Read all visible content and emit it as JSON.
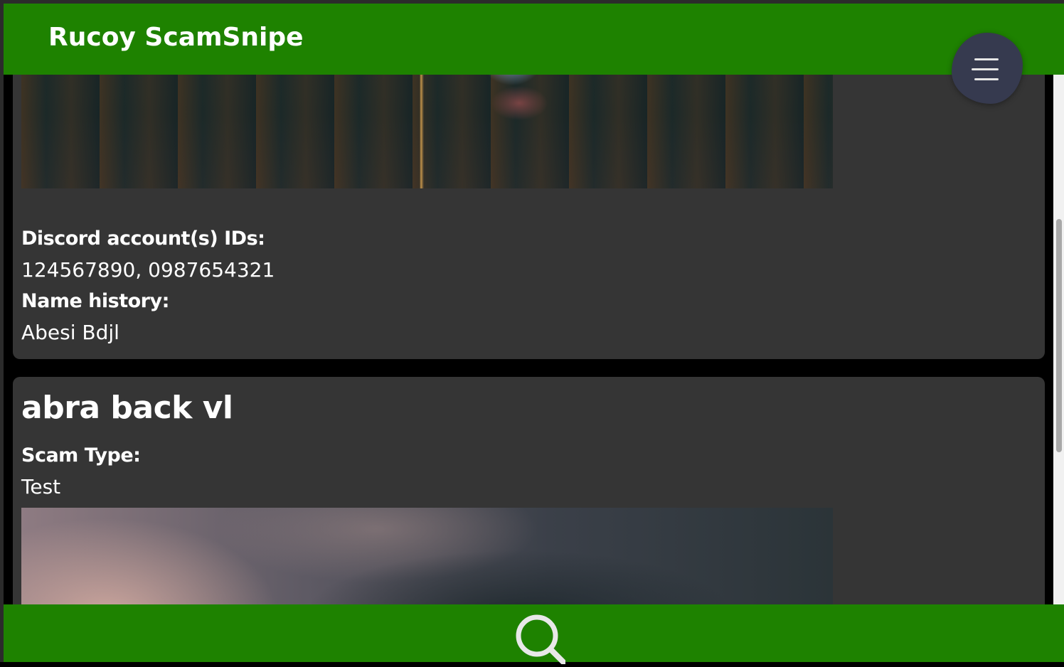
{
  "header": {
    "brand": "Rucoy ScamSnipe",
    "menu_icon": "hamburger-menu-icon"
  },
  "entries": [
    {
      "discord_label": "Discord account(s) IDs:",
      "discord_ids": "124567890, 0987654321",
      "name_history_label": "Name history:",
      "name_history": "Abesi Bdjl"
    },
    {
      "title": "abra back vl",
      "scam_type_label": "Scam Type:",
      "scam_type": "Test"
    }
  ],
  "footer": {
    "search_icon": "search-icon"
  },
  "colors": {
    "primary_green": "#1e8200",
    "card_bg": "#353535",
    "menu_button_bg": "#363a4f"
  }
}
